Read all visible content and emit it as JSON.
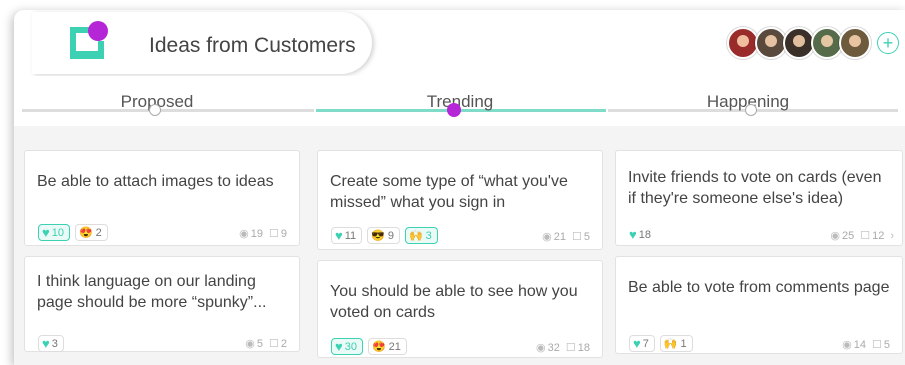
{
  "board": {
    "title": "Ideas from Customers",
    "add_member": "+"
  },
  "members": [
    {
      "color": "#9a2b2b"
    },
    {
      "color": "#5a4a3e"
    },
    {
      "color": "#3b2f2a"
    },
    {
      "color": "#556b4a"
    },
    {
      "color": "#6e5a3c"
    }
  ],
  "tabs": [
    {
      "label": "Proposed"
    },
    {
      "label": "Trending"
    },
    {
      "label": "Happening"
    }
  ],
  "accent": {
    "teal": "#3dd1b3",
    "purple": "#b526d6"
  },
  "cards": [
    {
      "text": "Be able to attach images to ideas",
      "hearts": "10",
      "heart_on": true,
      "reactions": [
        {
          "emoji": "😍",
          "count": "2"
        }
      ],
      "views": "19",
      "comments": "9"
    },
    {
      "text": "I think language on our landing page should be more “spunky”...",
      "hearts": "3",
      "heart_on": false,
      "reactions": [],
      "views": "5",
      "comments": "2"
    },
    {
      "text": "Create some type of “what you've missed” what you sign in",
      "hearts": "11",
      "heart_on": false,
      "reactions": [
        {
          "emoji": "😎",
          "count": "9"
        },
        {
          "emoji": "🙌",
          "count": "3",
          "on": true
        }
      ],
      "views": "21",
      "comments": "5"
    },
    {
      "text": "You should be able to see how you voted on cards",
      "hearts": "30",
      "heart_on": true,
      "reactions": [
        {
          "emoji": "😍",
          "count": "21"
        }
      ],
      "views": "32",
      "comments": "18"
    },
    {
      "text": "Invite friends to vote on cards (even if they're someone else's idea)",
      "hearts": "18",
      "heart_on": false,
      "reactions": [],
      "views": "25",
      "comments": "12"
    },
    {
      "text": "Be able to vote from comments page",
      "hearts": "7",
      "heart_on": false,
      "reactions": [
        {
          "emoji": "🙌",
          "count": "1"
        }
      ],
      "views": "14",
      "comments": "5"
    }
  ]
}
